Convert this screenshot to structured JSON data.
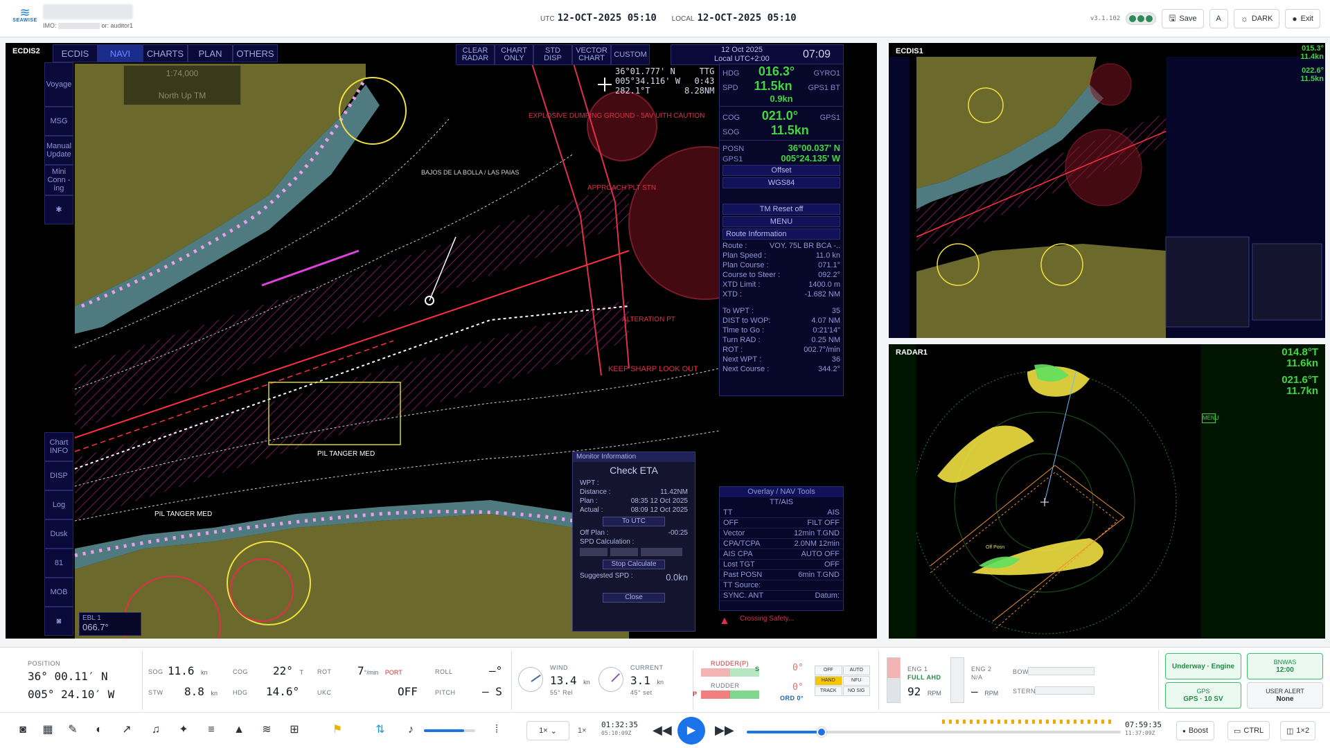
{
  "header": {
    "brand": "SEAWISE",
    "imo_label": "IMO:",
    "user_label": "or: auditor1",
    "utc_label": "UTC",
    "utc_time": "12-OCT-2025 05:10",
    "local_label": "LOCAL",
    "local_time": "12-OCT-2025 05:10",
    "version": "v3.1.102",
    "save_label": "Save",
    "font_label": "A",
    "theme_label": "DARK",
    "exit_label": "Exit"
  },
  "ecdis2": {
    "label": "ECDIS2",
    "tabs": [
      "ECDIS",
      "NAVI",
      "CHARTS",
      "PLAN",
      "OTHERS"
    ],
    "active_tab": "NAVI",
    "top_menu": [
      {
        "l1": "CLEAR",
        "l2": "RADAR"
      },
      {
        "l1": "CHART",
        "l2": "ONLY"
      },
      {
        "l1": "STD",
        "l2": "DISP"
      },
      {
        "l1": "VECTOR",
        "l2": "CHART"
      },
      {
        "l1": "CUSTOM",
        "l2": ""
      }
    ],
    "date_display": "12 Oct 2025",
    "local_utc": "Local UTC+2:00",
    "time_display": "07:09",
    "scale": "1:74,000",
    "orientation": "North Up TM",
    "cursor_lat": "36°01.777' N",
    "cursor_lon": "005°34.116' W",
    "cursor_brg": "282.1°T",
    "ttg_label": "TTG",
    "ttg_value": "0:43",
    "ttg_dist": "8.28NM",
    "sidebar": [
      "Voyage",
      "MSG",
      "Manual Update",
      "Mini Conn -ing",
      "",
      "Chart INFO",
      "DISP",
      "Log",
      "Dusk",
      "81",
      "MOB",
      ""
    ],
    "hdg_label": "HDG",
    "hdg_value": "016.3°",
    "hdg_src": "GYRO1",
    "spd_label": "SPD",
    "spd_value": "11.5kn",
    "spd_sub": "0.9kn",
    "spd_src": "GPS1 BT",
    "cog_label": "COG",
    "cog_value": "021.0°",
    "sog_label": "SOG",
    "sog_value": "11.5kn",
    "cog_src": "GPS1",
    "posn_label": "POSN",
    "posn_lat": "36°00.037' N",
    "posn_src": "GPS1",
    "posn_lon": "005°24.135' W",
    "offset_label": "Offset",
    "datum": "WGS84",
    "tm_reset": "TM Reset off",
    "menu_label": "MENU",
    "route_info_title": "Route Information",
    "route": [
      {
        "k": "Route :",
        "v": "VOY. 75L BR BCA -.."
      },
      {
        "k": "Plan Speed :",
        "v": "11.0 kn"
      },
      {
        "k": "Plan Course :",
        "v": "071.1°"
      },
      {
        "k": "Course to Steer :",
        "v": "092.2°"
      },
      {
        "k": "XTD Limit :",
        "v": "1400.0 m"
      },
      {
        "k": "XTD :",
        "v": "-1.682 NM"
      }
    ],
    "route2": [
      {
        "k": "To WPT :",
        "v": "35"
      },
      {
        "k": "DIST to WOP:",
        "v": "4.07 NM"
      },
      {
        "k": "Time to Go :",
        "v": "0:21'14\""
      },
      {
        "k": "Turn RAD :",
        "v": "0.25 NM"
      },
      {
        "k": "ROT :",
        "v": "002.7°/min"
      },
      {
        "k": "Next WPT :",
        "v": "36"
      },
      {
        "k": "Next Course :",
        "v": "344.2°"
      }
    ],
    "monitor": {
      "head": "Monitor Information",
      "title": "Check ETA",
      "rows": [
        {
          "k": "WPT :",
          "v": ""
        },
        {
          "k": "Distance :",
          "v": "11.42NM"
        },
        {
          "k": "Plan :",
          "v": "08:35 12 Oct 2025"
        },
        {
          "k": "Actual :",
          "v": "08:09 12 Oct 2025"
        }
      ],
      "to_utc": "To UTC",
      "off_plan_label": "Off Plan :",
      "off_plan": "-00:25",
      "spd_calc": "SPD Calculation :",
      "stop_calc": "Stop Calculate",
      "suggested_label": "Suggested SPD :",
      "suggested": "0.0kn",
      "close": "Close"
    },
    "overlay": {
      "title": "Overlay / NAV Tools",
      "tab": "TT/AIS",
      "rows": [
        {
          "k": "TT",
          "v": "AIS"
        },
        {
          "k": "OFF",
          "v": "FILT OFF"
        },
        {
          "k": "Vector",
          "v": "12min  T.GND"
        },
        {
          "k": "CPA/TCPA",
          "v": "2.0NM  12min"
        },
        {
          "k": "AIS CPA",
          "v": "AUTO OFF"
        },
        {
          "k": "Lost TGT",
          "v": "OFF"
        },
        {
          "k": "Past POSN",
          "v": "6min  T.GND"
        }
      ],
      "tt_source": "TT Source:",
      "sync": "SYNC. ANT",
      "datum": "Datum:"
    },
    "alert_text": "Crossing Safety...",
    "ebl_label": "EBL 1",
    "ebl_value": "066.7°",
    "chart_labels": [
      "EXPLOSIVE DUMPING GROUND - 5AV UITH CAUTION",
      "APPROACH PLT STN",
      "ALTERATION PT",
      "KEEP SHARP LOOK OUT",
      "PIL TANGER MED",
      "PIL TANGER MED",
      "BAJOS DE LA BOLLA / LAS PAIAS"
    ]
  },
  "ecdis1": {
    "label": "ECDIS1",
    "hdg": "015.3°",
    "spd": "11.4kn",
    "cog": "022.6°",
    "sog": "11.5kn"
  },
  "radar1": {
    "label": "RADAR1",
    "hdg": "014.8°T",
    "spd": "11.6kn",
    "cog": "021.6°T",
    "sog": "11.7kn",
    "menu": "MENU",
    "tag": "Off Posn"
  },
  "status": {
    "position_label": "POSITION",
    "lat": "36° 00.11′ N",
    "lon": "005° 24.10′ W",
    "sog_label": "SOG",
    "sog": "11.6",
    "sog_unit": "kn",
    "stw_label": "STW",
    "stw": "8.8",
    "stw_unit": "kn",
    "cog_label": "COG",
    "cog": "22°",
    "cog_unit": "T",
    "hdg_label": "HDG",
    "hdg": "14.6°",
    "rot_label": "ROT",
    "rot": "7",
    "rot_unit": "°/min",
    "rot_dir": "PORT",
    "ukc_label": "UKC",
    "ukc": "OFF",
    "roll_label": "ROLL",
    "roll": "—°",
    "pitch_label": "PITCH",
    "pitch": "— S",
    "wind_label": "WIND",
    "wind": "13.4",
    "wind_unit": "kn",
    "wind_dir": "55° Rel",
    "current_label": "CURRENT",
    "current": "3.1",
    "current_unit": "kn",
    "current_dir": "45° set",
    "rudder_p_label": "RUDDER(P)",
    "rudder_label": "RUDDER",
    "rudder_p": "P",
    "rudder_s": "S",
    "rudder_val1": "0°",
    "rudder_val2": "0°",
    "ord_label": "ORD 0°",
    "autopilot": [
      "OFF",
      "AUTO",
      "HAND",
      "NFU",
      "TRACK",
      "NO SIG"
    ],
    "autopilot_active": "HAND",
    "eng1_label": "ENG 1",
    "eng1_state": "FULL AHD",
    "eng1_rpm": "92",
    "eng1_unit": "RPM",
    "eng2_label": "ENG 2",
    "eng2_state": "N/A",
    "eng2_rpm": "—",
    "eng2_unit": "RPM",
    "bow_label": "BOW",
    "stern_label": "STERN",
    "state_underway": "Underway · Engine",
    "bnwas_label": "BNWAS",
    "bnwas_value": "12:00",
    "gps_label": "GPS",
    "gps_value": "GPS · 10 SV",
    "user_alert_label": "USER ALERT",
    "user_alert_value": "None"
  },
  "toolbar": {
    "speed_select": "1×",
    "speed_text": "1×",
    "elapsed": "01:32:35",
    "elapsed_sub": "05:10:09Z",
    "end_time": "07:59:35",
    "end_sub": "11:37:09Z",
    "progress": 0.2,
    "volume": 0.78,
    "boost_label": "Boost",
    "ctrl_label": "CTRL",
    "layout_label": "1×2"
  },
  "colors": {
    "accent": "#1a73e8",
    "ecdis_green": "#42d642",
    "land": "#6b6a2c",
    "shallow": "#5f8a8c",
    "danger": "#e0304a",
    "radar_echo": "#f0e040"
  }
}
